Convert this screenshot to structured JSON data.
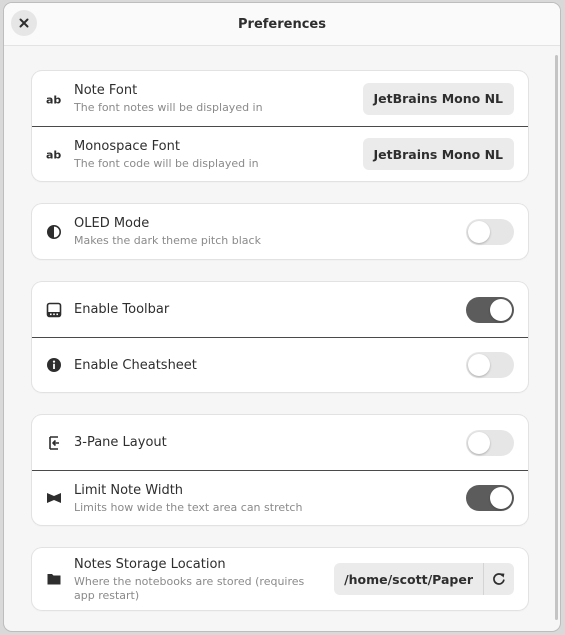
{
  "window": {
    "title": "Preferences",
    "close_icon": "close-icon"
  },
  "fonts_group": {
    "note_font": {
      "icon": "font-ab-icon",
      "title": "Note Font",
      "subtitle": "The font notes will be displayed in",
      "value": "JetBrains Mono NL"
    },
    "monospace_font": {
      "icon": "font-ab-icon",
      "title": "Monospace Font",
      "subtitle": "The font code will be displayed in",
      "value": "JetBrains Mono NL"
    }
  },
  "oled_group": {
    "oled_mode": {
      "icon": "contrast-icon",
      "title": "OLED Mode",
      "subtitle": "Makes the dark theme pitch black",
      "enabled": false
    }
  },
  "ui_group": {
    "toolbar": {
      "icon": "toolbar-icon",
      "title": "Enable Toolbar",
      "enabled": true
    },
    "cheatsheet": {
      "icon": "info-icon",
      "title": "Enable Cheatsheet",
      "enabled": false
    }
  },
  "layout_group": {
    "three_pane": {
      "icon": "pane-layout-icon",
      "title": "3-Pane Layout",
      "enabled": false
    },
    "limit_width": {
      "icon": "limit-width-icon",
      "title": "Limit Note Width",
      "subtitle": "Limits how wide the text area can stretch",
      "enabled": true
    }
  },
  "storage_group": {
    "location": {
      "icon": "folder-icon",
      "title": "Notes Storage Location",
      "subtitle": "Where the notebooks are stored (requires app restart)",
      "value": "/home/scott/Paper",
      "reset_icon": "refresh-icon"
    }
  },
  "colors": {
    "toggle_on": "#5c5c5c",
    "toggle_off": "#e6e6e6",
    "button_bg": "#ebebeb"
  }
}
